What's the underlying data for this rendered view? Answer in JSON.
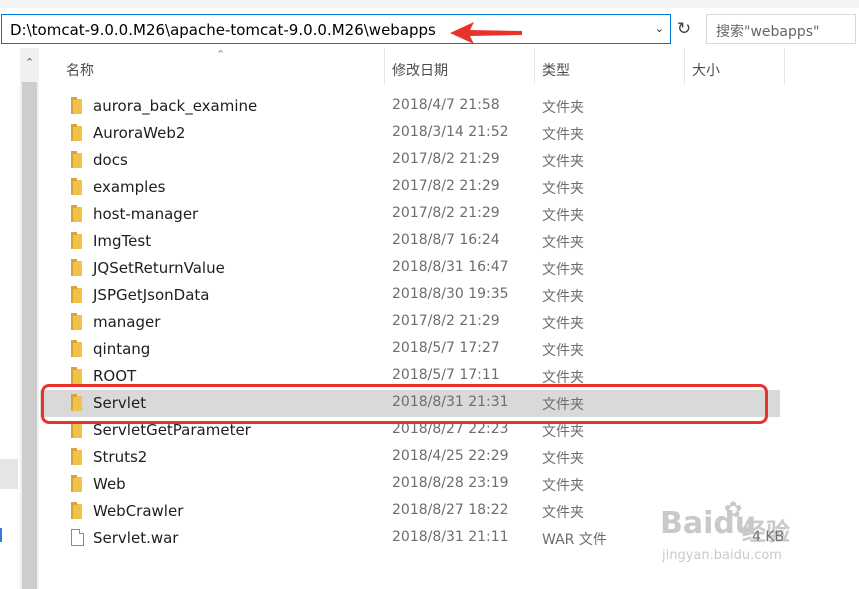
{
  "address": {
    "path": "D:\\tomcat-9.0.0.M26\\apache-tomcat-9.0.0.M26\\webapps",
    "dropdown_icon": "chevron-down-icon",
    "refresh_icon": "refresh-icon"
  },
  "search": {
    "placeholder": "搜索\"webapps\""
  },
  "columns": {
    "name": "名称",
    "date": "修改日期",
    "type": "类型",
    "size": "大小"
  },
  "files": [
    {
      "name": "aurora_back_examine",
      "date": "2018/4/7 21:58",
      "type": "文件夹",
      "size": "",
      "icon": "folder-icon"
    },
    {
      "name": "AuroraWeb2",
      "date": "2018/3/14 21:52",
      "type": "文件夹",
      "size": "",
      "icon": "folder-icon"
    },
    {
      "name": "docs",
      "date": "2017/8/2 21:29",
      "type": "文件夹",
      "size": "",
      "icon": "folder-icon"
    },
    {
      "name": "examples",
      "date": "2017/8/2 21:29",
      "type": "文件夹",
      "size": "",
      "icon": "folder-icon"
    },
    {
      "name": "host-manager",
      "date": "2017/8/2 21:29",
      "type": "文件夹",
      "size": "",
      "icon": "folder-icon"
    },
    {
      "name": "ImgTest",
      "date": "2018/8/7 16:24",
      "type": "文件夹",
      "size": "",
      "icon": "folder-icon"
    },
    {
      "name": "JQSetReturnValue",
      "date": "2018/8/31 16:47",
      "type": "文件夹",
      "size": "",
      "icon": "folder-icon"
    },
    {
      "name": "JSPGetJsonData",
      "date": "2018/8/30 19:35",
      "type": "文件夹",
      "size": "",
      "icon": "folder-icon"
    },
    {
      "name": "manager",
      "date": "2017/8/2 21:29",
      "type": "文件夹",
      "size": "",
      "icon": "folder-icon"
    },
    {
      "name": "qintang",
      "date": "2018/5/7 17:27",
      "type": "文件夹",
      "size": "",
      "icon": "folder-icon"
    },
    {
      "name": "ROOT",
      "date": "2018/5/7 17:11",
      "type": "文件夹",
      "size": "",
      "icon": "folder-icon"
    },
    {
      "name": "Servlet",
      "date": "2018/8/31 21:31",
      "type": "文件夹",
      "size": "",
      "icon": "folder-icon",
      "selected": true
    },
    {
      "name": "ServletGetParameter",
      "date": "2018/8/27 22:23",
      "type": "文件夹",
      "size": "",
      "icon": "folder-icon"
    },
    {
      "name": "Struts2",
      "date": "2018/4/25 22:29",
      "type": "文件夹",
      "size": "",
      "icon": "folder-icon"
    },
    {
      "name": "Web",
      "date": "2018/8/28 23:19",
      "type": "文件夹",
      "size": "",
      "icon": "folder-icon"
    },
    {
      "name": "WebCrawler",
      "date": "2018/8/27 18:22",
      "type": "文件夹",
      "size": "",
      "icon": "folder-icon"
    },
    {
      "name": "Servlet.war",
      "date": "2018/8/31 21:11",
      "type": "WAR 文件",
      "size": "4 KB",
      "icon": "file-icon"
    }
  ],
  "annotations": {
    "arrow_color": "#e8332a",
    "highlight_color": "#e8332a"
  },
  "watermark": {
    "logo": "Baidu",
    "label": "经验",
    "url": "jingyan.baidu.com"
  },
  "colors": {
    "selection": "#d9d9d9",
    "address_border": "#0078d7",
    "folder": "#f0c24a"
  }
}
